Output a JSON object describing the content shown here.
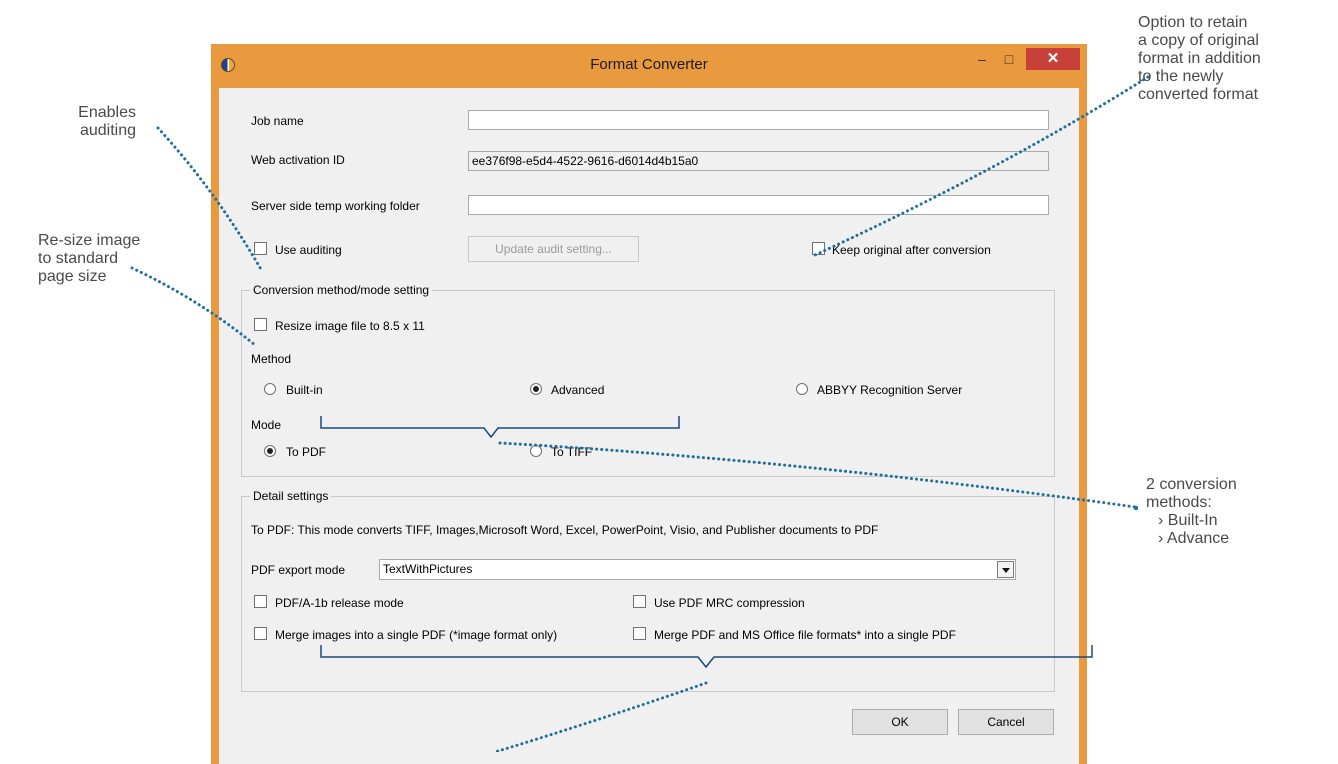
{
  "window": {
    "title": "Format Converter",
    "minimize_glyph": "–",
    "maximize_glyph": "□",
    "close_glyph": "✕"
  },
  "fields": {
    "job_name_label": "Job name",
    "job_name_value": "",
    "web_activation_label": "Web activation ID",
    "web_activation_value": "ee376f98-e5d4-4522-9616-d6014d4b15a0",
    "temp_folder_label": "Server side temp working folder",
    "temp_folder_value": ""
  },
  "options": {
    "use_auditing": {
      "label": "Use auditing",
      "checked": false
    },
    "update_audit_button": "Update audit setting...",
    "keep_original": {
      "label": "Keep original after conversion",
      "checked": false
    }
  },
  "conversion": {
    "legend": "Conversion method/mode setting",
    "resize": {
      "label": "Resize image file to 8.5 x 11",
      "checked": false
    },
    "method_label": "Method",
    "methods": [
      {
        "label": "Built-in",
        "selected": false
      },
      {
        "label": "Advanced",
        "selected": true
      },
      {
        "label": "ABBYY Recognition Server",
        "selected": false
      }
    ],
    "mode_label": "Mode",
    "modes": [
      {
        "label": "To PDF",
        "selected": true
      },
      {
        "label": "To TIFF",
        "selected": false
      }
    ]
  },
  "detail": {
    "legend": "Detail settings",
    "description": "To PDF: This mode converts TIFF, Images,Microsoft Word, Excel, PowerPoint, Visio, and Publisher documents to PDF",
    "export_mode_label": "PDF export mode",
    "export_mode_value": "TextWithPictures",
    "pdfa": {
      "label": "PDF/A-1b release mode",
      "checked": false
    },
    "mrc": {
      "label": "Use PDF MRC compression",
      "checked": false
    },
    "merge_images": {
      "label": "Merge images into a single PDF (*image format only)",
      "checked": false
    },
    "merge_pdf_office": {
      "label": "Merge PDF and MS Office file formats* into a single PDF",
      "checked": false
    }
  },
  "buttons": {
    "ok": "OK",
    "cancel": "Cancel"
  },
  "annotations": {
    "auditing": [
      "Enables",
      "auditing"
    ],
    "resize": [
      "Re-size image",
      "to standard",
      "page size"
    ],
    "keep_original": [
      "Option to retain",
      "a copy of original",
      "format in addition",
      "to the newly",
      "converted format"
    ],
    "methods_title": [
      "2 conversion",
      "methods:"
    ],
    "methods_items": [
      "› Built-In",
      "› Advance"
    ],
    "accent_color": "#1f6f9f"
  }
}
